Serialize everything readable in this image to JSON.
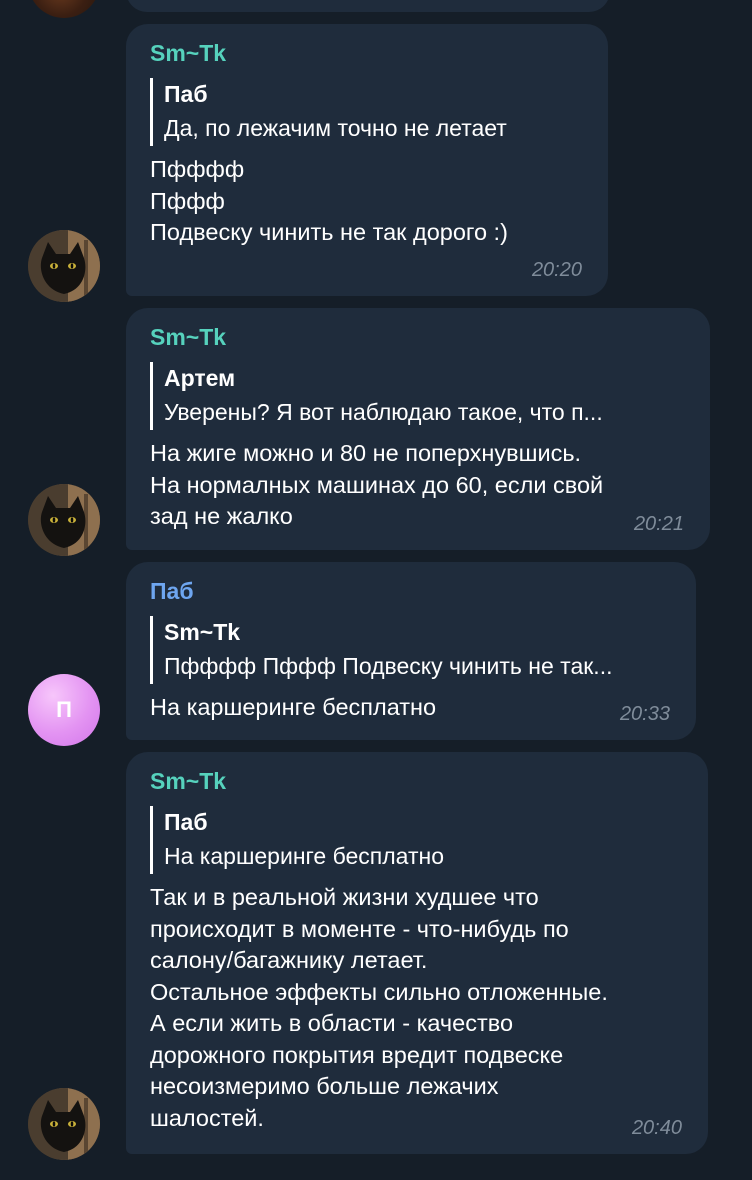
{
  "messages": [
    {
      "sender": "Sm~Tk",
      "reply_author": "Паб",
      "reply_text": "Да, по лежачим точно не летает",
      "text": "Пфффф\nПффф\nПодвеску чинить не так дорого :)",
      "time": "20:20",
      "avatar_icon": "cat-avatar"
    },
    {
      "sender": "Sm~Tk",
      "reply_author": "Артем",
      "reply_text": "Уверены? Я вот наблюдаю такое, что п...",
      "text": "На жиге можно и 80 не поперхнувшись.\nНа нормалных машинах до 60, если свой\nзад не жалко",
      "time": "20:21",
      "avatar_icon": "cat-avatar"
    },
    {
      "sender": "Паб",
      "reply_author": "Sm~Tk",
      "reply_text": "Пфффф Пффф Подвеску чинить не так...",
      "text": "На каршеринге бесплатно",
      "time": "20:33",
      "avatar_letter": "П"
    },
    {
      "sender": "Sm~Tk",
      "reply_author": "Паб",
      "reply_text": "На каршеринге бесплатно",
      "text": "Так и в реальной жизни худшее что\nпроисходит в моменте - что-нибудь по\nсалону/багажнику летает.\nОстальное эффекты сильно отложенные.\nА если жить в области - качество\nдорожного покрытия вредит подвеске\nнесоизмеримо больше лежачих\nшалостей.",
      "time": "20:40",
      "avatar_icon": "cat-avatar"
    }
  ],
  "colors": {
    "background": "#151e28",
    "bubble": "#1f2c3c",
    "sender_smtk": "#56d2bd",
    "sender_pab": "#6ea6f0",
    "time": "#7f8c9a"
  }
}
